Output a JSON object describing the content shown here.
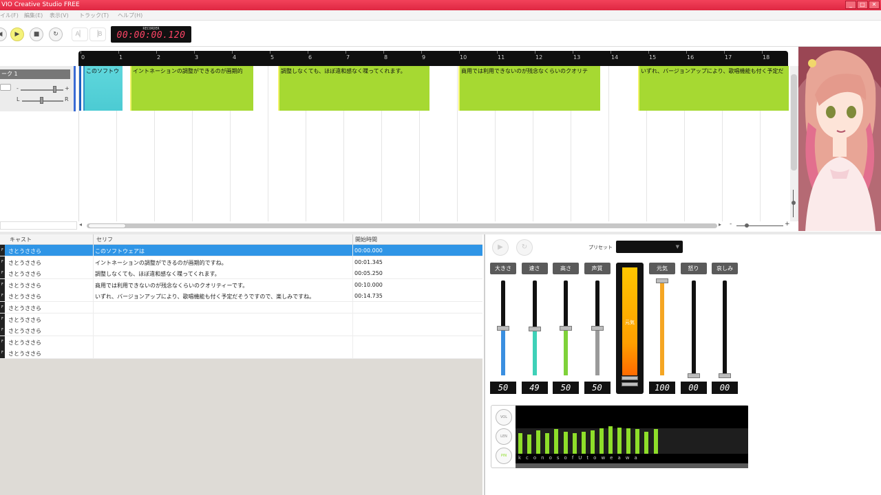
{
  "window": {
    "title": "VIO Creative Studio FREE",
    "buttons": [
      "_",
      "□",
      "✕"
    ]
  },
  "menu": [
    "イル(F)",
    "編集(E)",
    "表示(V)",
    "トラック(T)",
    "ヘルプ(H)"
  ],
  "transport": {
    "timecode": "00:00:00.120",
    "rec_label": "RECORDER",
    "play_icon": "play-icon",
    "stop_icon": "stop-icon",
    "loop_icon": "loop-icon"
  },
  "timeline": {
    "ticks": [
      "0",
      "1",
      "2",
      "3",
      "4",
      "5",
      "6",
      "7",
      "8",
      "9",
      "10",
      "11",
      "12",
      "13",
      "14",
      "15",
      "16",
      "17",
      "18"
    ],
    "track": {
      "name": "ーク 1",
      "pan_left": "L",
      "pan_right": "R",
      "vol_minus": "-",
      "vol_plus": "+"
    },
    "clips": [
      {
        "text": "このソフトウ",
        "style": "cyan"
      },
      {
        "text": "イントネーションの調整ができるのが画期的",
        "style": "green"
      },
      {
        "text": "調整しなくても、ほぼ違和感なく喋ってくれます。",
        "style": "green"
      },
      {
        "text": "商用では利用できないのが残念なくらいのクオリテ",
        "style": "green"
      },
      {
        "text": "いずれ、バージョンアップにより、歌唱機能も付く予定だ",
        "style": "green"
      }
    ],
    "zoom_minus": "-",
    "zoom_plus": "+"
  },
  "list": {
    "headers": [
      "キャスト",
      "セリフ",
      "開始時間"
    ],
    "rows": [
      {
        "cast": "さとうささら",
        "line": "このソフトウェアは",
        "start": "00:00.000",
        "selected": true
      },
      {
        "cast": "さとうささら",
        "line": "イントネーションの調整ができるのが画期的ですね。",
        "start": "00:01.345"
      },
      {
        "cast": "さとうささら",
        "line": "調整しなくても、ほぼ違和感なく喋ってくれます。",
        "start": "00:05.250"
      },
      {
        "cast": "さとうささら",
        "line": "商用では利用できないのが残念なくらいのクオリティーです。",
        "start": "00:10.000"
      },
      {
        "cast": "さとうささら",
        "line": "いずれ、バージョンアップにより、歌唱機能も付く予定だそうですので、楽しみですね。",
        "start": "00:14.735"
      },
      {
        "cast": "さとうささら",
        "line": "",
        "start": ""
      },
      {
        "cast": "さとうささら",
        "line": "",
        "start": ""
      },
      {
        "cast": "さとうささら",
        "line": "",
        "start": ""
      },
      {
        "cast": "さとうささら",
        "line": "",
        "start": ""
      },
      {
        "cast": "さとうささら",
        "line": "",
        "start": ""
      }
    ],
    "row_marker": "F"
  },
  "panel": {
    "preset_label": "プリセット",
    "params": [
      {
        "label": "大きさ",
        "value": "50",
        "level": 0.5,
        "color": "#3a8fe0"
      },
      {
        "label": "速さ",
        "value": "49",
        "level": 0.49,
        "color": "#3fd1b8"
      },
      {
        "label": "高さ",
        "value": "50",
        "level": 0.5,
        "color": "#7fd23a"
      },
      {
        "label": "声質",
        "value": "50",
        "level": 0.5,
        "color": "#9a9a9a"
      }
    ],
    "emotion_meter_label": "元気",
    "emotions": [
      {
        "label": "元気",
        "value": "100",
        "level": 1.0,
        "color": "#f5a623"
      },
      {
        "label": "怒り",
        "value": "00",
        "level": 0.0,
        "color": "#777777"
      },
      {
        "label": "哀しみ",
        "value": "00",
        "level": 0.0,
        "color": "#777777"
      }
    ],
    "wave_buttons": [
      "VOL",
      "LEN",
      "PIN"
    ],
    "phonemes": "kconosofUtoweawa"
  }
}
